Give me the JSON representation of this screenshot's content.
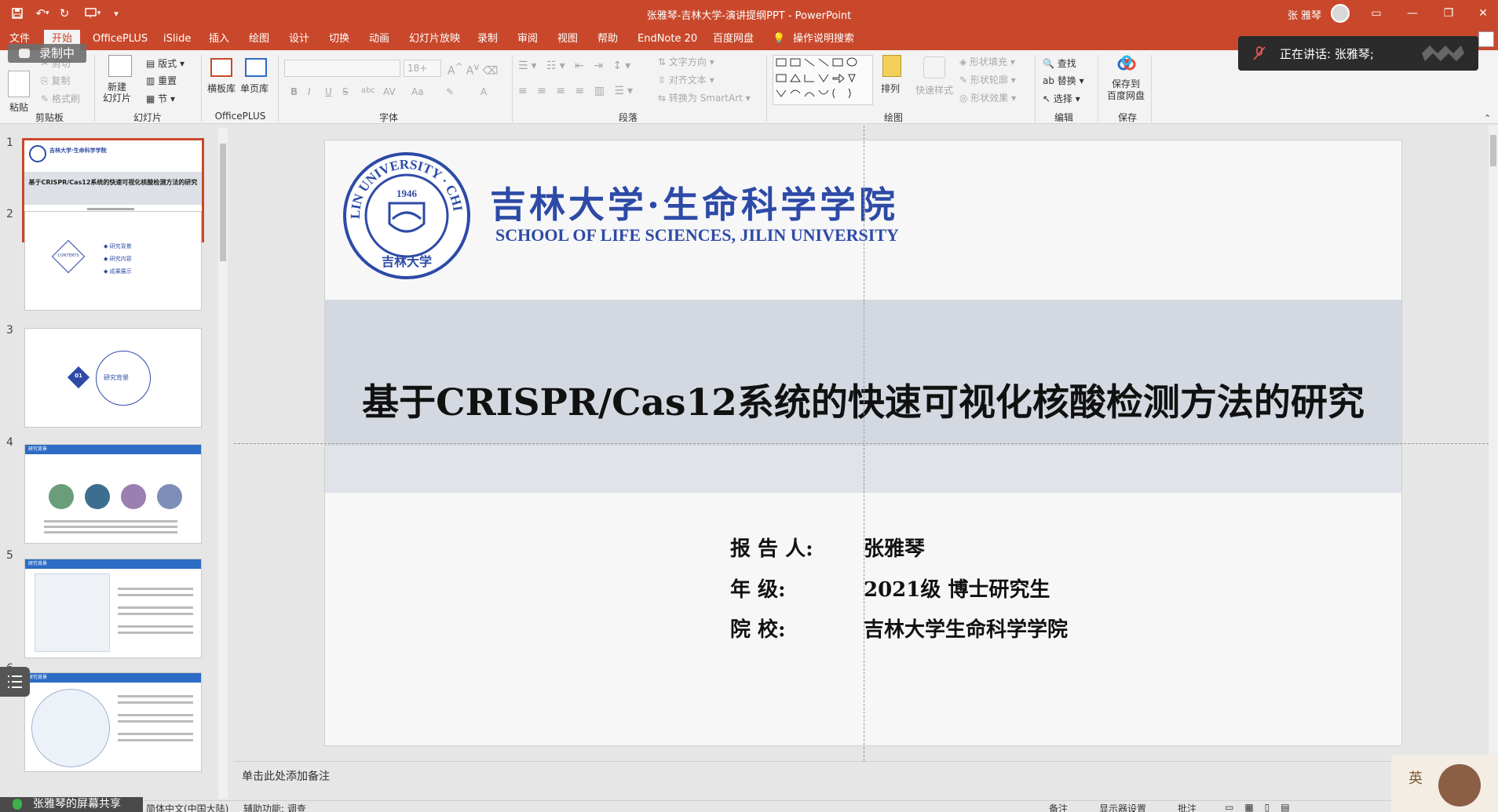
{
  "window": {
    "title": "张雅琴-吉林大学-演讲提纲PPT  -  PowerPoint",
    "user_name": "张 雅琴"
  },
  "tabs": [
    "文件",
    "开始",
    "OfficePLUS",
    "iSlide",
    "插入",
    "绘图",
    "设计",
    "切换",
    "动画",
    "幻灯片放映",
    "录制",
    "审阅",
    "视图",
    "帮助",
    "EndNote 20",
    "百度网盘",
    "操作说明搜索"
  ],
  "active_tab": "开始",
  "recording_label": "录制中",
  "speaking_label": "正在讲话: 张雅琴;",
  "ribbon": {
    "clipboard": {
      "label": "剪贴板",
      "paste": "粘贴",
      "cut": "剪切",
      "copy": "复制",
      "format_painter": "格式刷"
    },
    "slides": {
      "label": "幻灯片",
      "new_slide": "新建\n幻灯片",
      "layout": "版式",
      "reset": "重置",
      "section": "节"
    },
    "officeplus": {
      "label": "OfficePLUS",
      "templates": "横板库",
      "single": "单页库"
    },
    "font": {
      "label": "字体",
      "size": "18+",
      "bold": "B",
      "italic": "I",
      "underline": "U",
      "strike": "S",
      "shadow": "abc",
      "spacing": "AV",
      "case": "Aa",
      "font_color": "A"
    },
    "paragraph": {
      "label": "段落",
      "text_direction": "文字方向",
      "align_text": "对齐文本",
      "smartart": "转换为 SmartArt"
    },
    "drawing": {
      "label": "绘图",
      "arrange": "排列",
      "quick_styles": "快速样式",
      "fill": "形状填充",
      "outline": "形状轮廓",
      "effects": "形状效果"
    },
    "editing": {
      "label": "编辑",
      "find": "查找",
      "replace": "替换",
      "select": "选择"
    },
    "save": {
      "label": "保存",
      "save_to": "保存到\n百度网盘"
    }
  },
  "thumbnails": [
    {
      "num": "1",
      "title": "基于CRISPR/Cas12系统的快速可视化核酸检测方法的研究",
      "header": "吉林大学·生命科学学院"
    },
    {
      "num": "2",
      "items": [
        "研究背景",
        "研究内容",
        "成果展示"
      ],
      "center": "CONTENTS"
    },
    {
      "num": "3",
      "badge": "01",
      "label": "研究背景"
    },
    {
      "num": "4",
      "header": "研究背景"
    },
    {
      "num": "5",
      "header": "研究背景"
    },
    {
      "num": "6",
      "header": "研究背景"
    }
  ],
  "slide": {
    "school_cn": "吉林大学·生命科学学院",
    "school_en": "SCHOOL OF LIFE SCIENCES, JILIN UNIVERSITY",
    "seal_top": "JILIN UNIVERSITY · CHINA",
    "seal_year": "1946",
    "seal_bottom": "吉林大学",
    "title": "基于CRISPR/Cas12系统的快速可视化核酸检测方法的研究",
    "info": [
      {
        "label": "报  告  人:",
        "value": "张雅琴"
      },
      {
        "label": "年      级:",
        "value": "2021级  博士研究生"
      },
      {
        "label": "院      校:",
        "value": "吉林大学生命科学学院"
      }
    ]
  },
  "notes_placeholder": "单击此处添加备注",
  "status": {
    "screen_share": "张雅琴的屏幕共享",
    "language": "简体中文(中国大陆)",
    "accessibility": "辅助功能: 调查",
    "notes": "备注",
    "display": "显示器设置",
    "comments": "批注"
  },
  "ime": "英",
  "colors": {
    "accent": "#c9482b",
    "brand_blue": "#2d4aa6"
  }
}
